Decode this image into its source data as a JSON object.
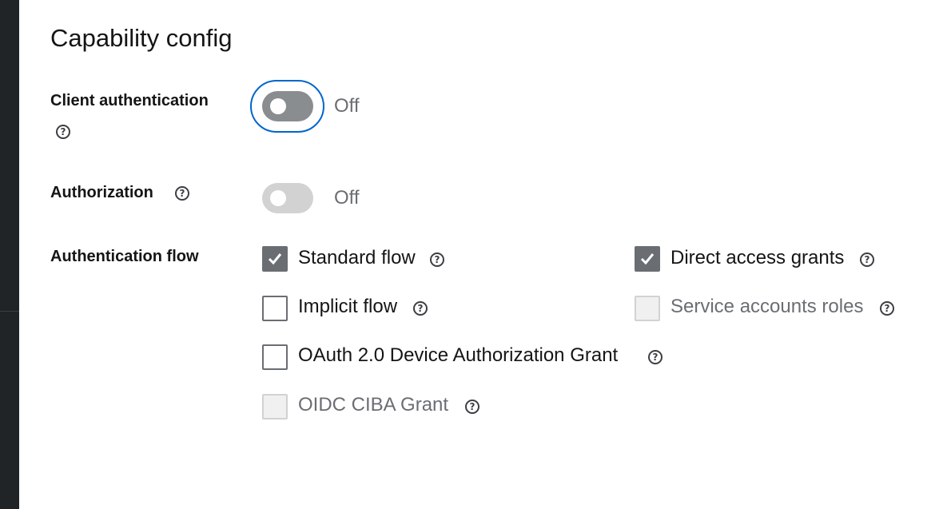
{
  "section": {
    "title": "Capability config"
  },
  "client_authentication": {
    "label": "Client authentication",
    "state_text": "Off",
    "enabled": false,
    "focused": true
  },
  "authorization": {
    "label": "Authorization",
    "state_text": "Off",
    "enabled": false,
    "disabled": true
  },
  "authentication_flow": {
    "label": "Authentication flow",
    "options": [
      {
        "label": "Standard flow",
        "checked": true,
        "disabled": false
      },
      {
        "label": "Direct access grants",
        "checked": true,
        "disabled": false
      },
      {
        "label": "Implicit flow",
        "checked": false,
        "disabled": false
      },
      {
        "label": "Service accounts roles",
        "checked": false,
        "disabled": true
      },
      {
        "label": "OAuth 2.0 Device Authorization Grant",
        "checked": false,
        "disabled": false
      },
      {
        "label": "OIDC CIBA Grant",
        "checked": false,
        "disabled": true
      }
    ]
  },
  "icons": {
    "help": "help-circle-icon",
    "check": "checkmark-icon"
  },
  "colors": {
    "focus_ring": "#0066cc",
    "switch_off": "#8a8d90",
    "switch_disabled": "#d2d2d2",
    "checkbox_checked": "#6a6e73",
    "sidebar": "#212427"
  }
}
